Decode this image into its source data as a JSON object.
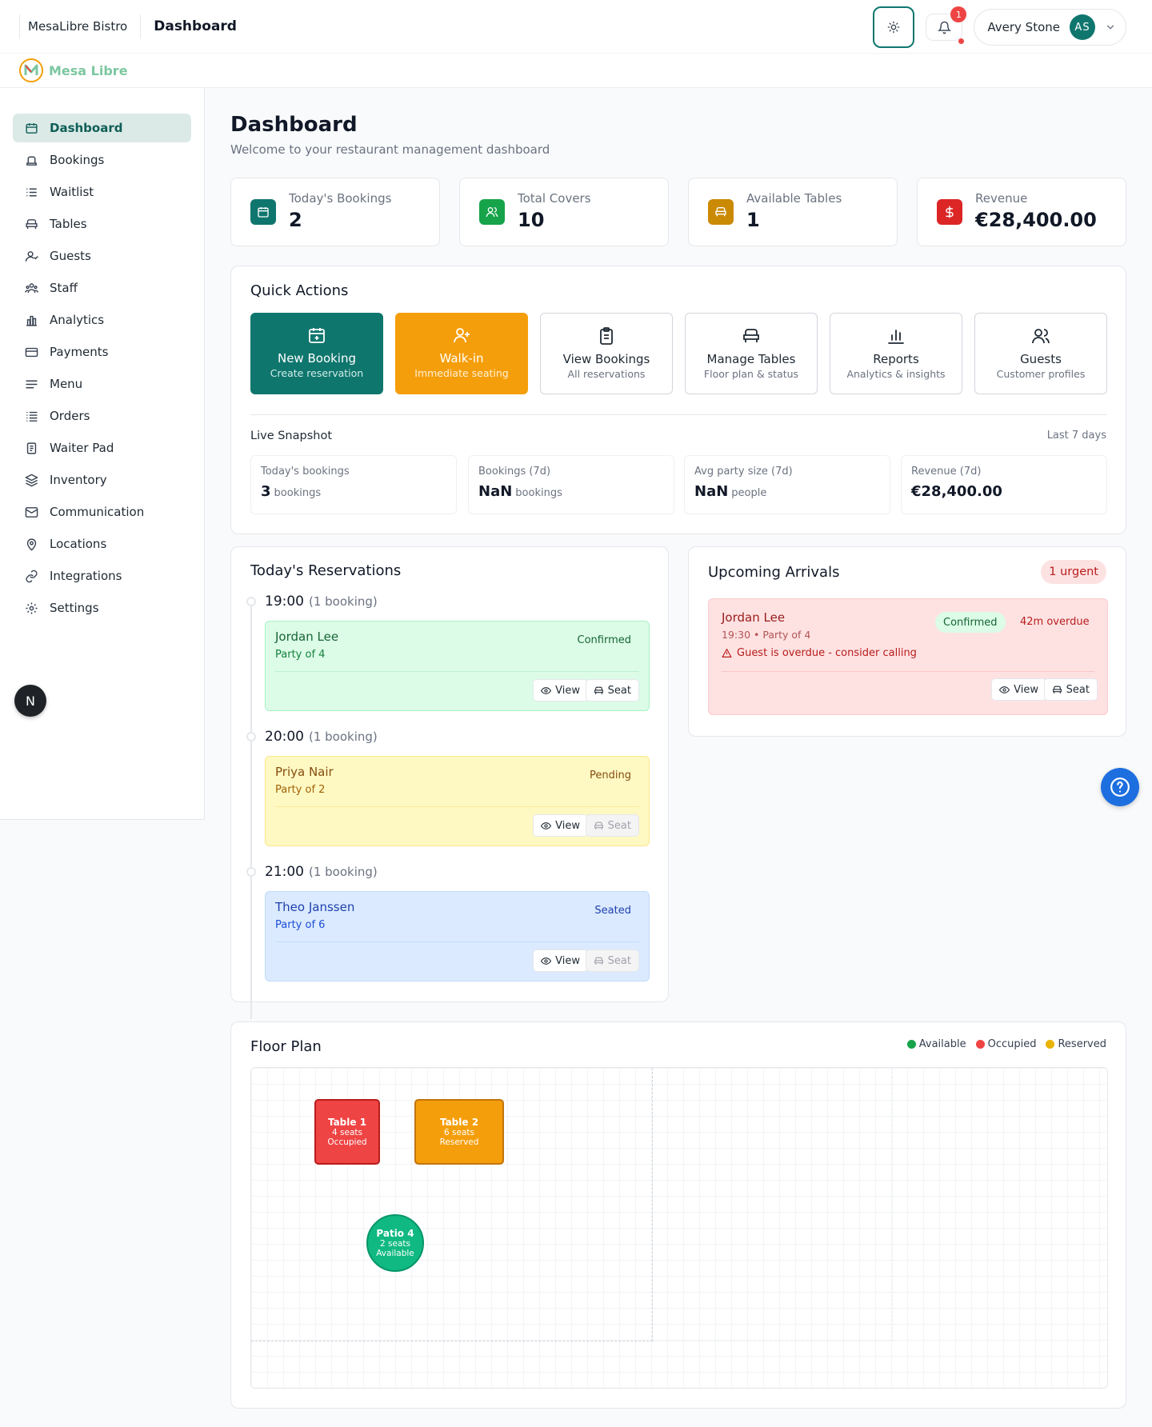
{
  "header": {
    "brand": "MesaLibre Bistro",
    "title": "Dashboard",
    "notification_count": "1",
    "user_name": "Avery Stone",
    "user_initials": "AS"
  },
  "logo": {
    "text": "Mesa Libre"
  },
  "sidebar": {
    "items": [
      {
        "label": "Dashboard",
        "icon": "dashboard-icon"
      },
      {
        "label": "Bookings",
        "icon": "bookings-icon"
      },
      {
        "label": "Waitlist",
        "icon": "waitlist-icon"
      },
      {
        "label": "Tables",
        "icon": "tables-icon"
      },
      {
        "label": "Guests",
        "icon": "guests-icon"
      },
      {
        "label": "Staff",
        "icon": "staff-icon"
      },
      {
        "label": "Analytics",
        "icon": "analytics-icon"
      },
      {
        "label": "Payments",
        "icon": "payments-icon"
      },
      {
        "label": "Menu",
        "icon": "menu-icon"
      },
      {
        "label": "Orders",
        "icon": "orders-icon"
      },
      {
        "label": "Waiter Pad",
        "icon": "waiter-pad-icon"
      },
      {
        "label": "Inventory",
        "icon": "inventory-icon"
      },
      {
        "label": "Communication",
        "icon": "mail-icon"
      },
      {
        "label": "Locations",
        "icon": "location-pin-icon"
      },
      {
        "label": "Integrations",
        "icon": "link-icon"
      },
      {
        "label": "Settings",
        "icon": "gear-icon"
      }
    ],
    "badge": "N"
  },
  "page": {
    "title": "Dashboard",
    "subtitle": "Welcome to your restaurant management dashboard"
  },
  "stats": [
    {
      "label": "Today's Bookings",
      "value": "2",
      "color": "#0f766e",
      "icon": "calendar-icon"
    },
    {
      "label": "Total Covers",
      "value": "10",
      "color": "#16a34a",
      "icon": "users-icon"
    },
    {
      "label": "Available Tables",
      "value": "1",
      "color": "#ca8a04",
      "icon": "chair-icon"
    },
    {
      "label": "Revenue",
      "value": "€28,400.00",
      "color": "#dc2626",
      "icon": "dollar-icon"
    }
  ],
  "quick_actions": {
    "title": "Quick Actions",
    "items": [
      {
        "label": "New Booking",
        "sub": "Create reservation",
        "icon": "calendar-plus-icon"
      },
      {
        "label": "Walk-in",
        "sub": "Immediate seating",
        "icon": "user-plus-icon"
      },
      {
        "label": "View Bookings",
        "sub": "All reservations",
        "icon": "clipboard-icon"
      },
      {
        "label": "Manage Tables",
        "sub": "Floor plan & status",
        "icon": "chair-icon"
      },
      {
        "label": "Reports",
        "sub": "Analytics & insights",
        "icon": "bar-chart-icon"
      },
      {
        "label": "Guests",
        "sub": "Customer profiles",
        "icon": "users-icon"
      }
    ],
    "snapshot_title": "Live Snapshot",
    "snapshot_range": "Last 7 days",
    "snapshot": [
      {
        "label": "Today's bookings",
        "value": "3",
        "unit": "bookings"
      },
      {
        "label": "Bookings (7d)",
        "value": "NaN",
        "unit": "bookings"
      },
      {
        "label": "Avg party size (7d)",
        "value": "NaN",
        "unit": "people"
      },
      {
        "label": "Revenue (7d)",
        "value": "€28,400.00",
        "unit": ""
      }
    ]
  },
  "reservations": {
    "title": "Today's Reservations",
    "groups": [
      {
        "time": "19:00",
        "count": "(1 booking)",
        "name": "Jordan Lee",
        "party": "Party of 4",
        "status": "Confirmed",
        "view": "View",
        "seat": "Seat"
      },
      {
        "time": "20:00",
        "count": "(1 booking)",
        "name": "Priya Nair",
        "party": "Party of 2",
        "status": "Pending",
        "view": "View",
        "seat": "Seat"
      },
      {
        "time": "21:00",
        "count": "(1 booking)",
        "name": "Theo Janssen",
        "party": "Party of 6",
        "status": "Seated",
        "view": "View",
        "seat": "Seat"
      }
    ]
  },
  "arrivals": {
    "title": "Upcoming Arrivals",
    "urgent_badge": "1 urgent",
    "items": [
      {
        "name": "Jordan Lee",
        "detail": "19:30 • Party of 4",
        "status": "Confirmed",
        "overdue": "42m overdue",
        "warning": "Guest is overdue - consider calling",
        "view": "View",
        "seat": "Seat"
      }
    ]
  },
  "floor_plan": {
    "title": "Floor Plan",
    "legend": [
      {
        "label": "Available",
        "color": "#16a34a"
      },
      {
        "label": "Occupied",
        "color": "#ef4444"
      },
      {
        "label": "Reserved",
        "color": "#eab308"
      }
    ],
    "tables": [
      {
        "name": "Table 1",
        "seats": "4 seats",
        "status": "Occupied",
        "shape": "rect",
        "color": "#ef4444"
      },
      {
        "name": "Table 2",
        "seats": "6 seats",
        "status": "Reserved",
        "shape": "rect",
        "color": "#f59e0b"
      },
      {
        "name": "Patio 4",
        "seats": "2 seats",
        "status": "Available",
        "shape": "circle",
        "color": "#10b981"
      }
    ]
  }
}
